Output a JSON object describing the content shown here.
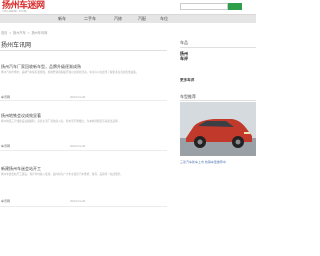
{
  "header": {
    "logo_name": "扬州车迷网",
    "logo_sub": "YZCHEMI.COM",
    "search_placeholder": ""
  },
  "nav": {
    "items": [
      "新车",
      "二手车",
      "汽修",
      "汽配",
      "车位"
    ]
  },
  "breadcrumb": [
    "首页",
    ">",
    "扬州汽车",
    ">",
    "扬州车讯网"
  ],
  "page_title": "扬州车讯网",
  "articles": [
    {
      "title": "扬州汽车厂家回收新车型，品牌升级逐渐成熟",
      "desc": "扬州汽车市场中，品牌汽车保有量增加，各地经销商积极开展以旧换新活动，车主可以在这里了解更多信息和优惠政策。",
      "author": "车讯网",
      "date": "2023-01-20"
    },
    {
      "title": "扬州地铁会议成效显著",
      "desc": "扬州地铁三号线建设进展顺利，多家主流厂商陆续入驻，新车型不断推出，为本地消费者带来更多选择。",
      "author": "车讯网",
      "date": "2023-01-20"
    },
    {
      "title": "新建扬州车迷会站开工",
      "desc": "扬州车迷会站开工建设，预计年内投入使用，届时将为广大车主提供汽车维修、保养、美容等一站式服务。",
      "author": "车讯网",
      "date": "2023-01-20"
    }
  ],
  "sidebar": {
    "heading1": "车品",
    "brand_lines": [
      "扬州",
      "车评"
    ],
    "brand_label": "更多车评",
    "heading2": "车型推荐",
    "car_caption": "三菱汽车新车上市 热销车型推荐中"
  },
  "colors": {
    "brand_red": "#d92b2b",
    "accent_green": "#2f9e4b",
    "car_red": "#c0392b"
  }
}
